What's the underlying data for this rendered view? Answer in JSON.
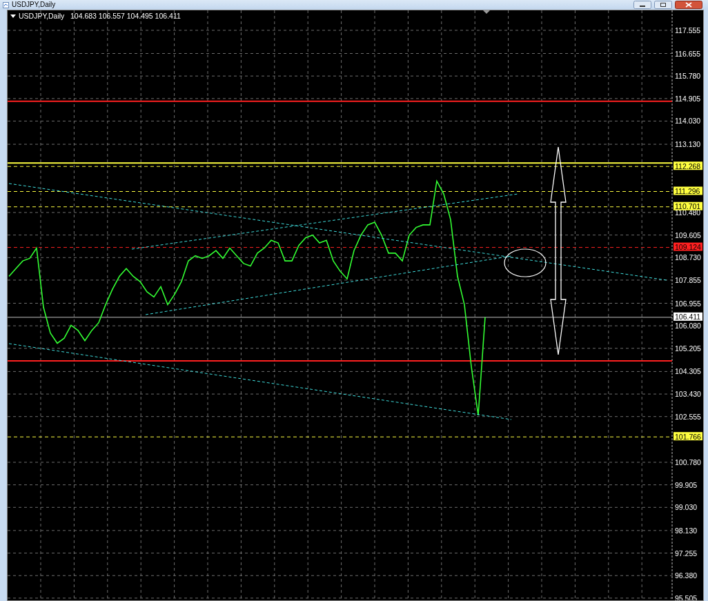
{
  "window": {
    "title": "USDJPY,Daily"
  },
  "chart": {
    "symbol": "USDJPY,Daily",
    "ohlc": [
      "104.683",
      "106.557",
      "104.495",
      "106.411"
    ],
    "chart_data": {
      "type": "line",
      "grid": true,
      "ylim": [
        95.42,
        118.33
      ],
      "yticks": [
        {
          "value": 117.555,
          "label": "117.555"
        },
        {
          "value": 116.655,
          "label": "116.655"
        },
        {
          "value": 115.78,
          "label": "115.780"
        },
        {
          "value": 114.905,
          "label": "114.905"
        },
        {
          "value": 114.03,
          "label": "114.030"
        },
        {
          "value": 113.13,
          "label": "113.130"
        },
        {
          "value": 110.48,
          "label": "110.480"
        },
        {
          "value": 109.605,
          "label": "109.605"
        },
        {
          "value": 108.73,
          "label": "108.730"
        },
        {
          "value": 107.855,
          "label": "107.855"
        },
        {
          "value": 106.955,
          "label": "106.955"
        },
        {
          "value": 106.08,
          "label": "106.080"
        },
        {
          "value": 105.205,
          "label": "105.205"
        },
        {
          "value": 104.305,
          "label": "104.305"
        },
        {
          "value": 103.43,
          "label": "103.430"
        },
        {
          "value": 102.555,
          "label": "102.555"
        },
        {
          "value": 100.78,
          "label": "100.780"
        },
        {
          "value": 99.905,
          "label": "99.905"
        },
        {
          "value": 99.03,
          "label": "99.030"
        },
        {
          "value": 98.13,
          "label": "98.130"
        },
        {
          "value": 97.255,
          "label": "97.255"
        },
        {
          "value": 96.38,
          "label": "96.380"
        },
        {
          "value": 95.505,
          "label": "95.505"
        }
      ],
      "series": [
        {
          "color": "#33ff33",
          "values": [
            108.0,
            108.3,
            108.6,
            108.7,
            109.1,
            106.8,
            105.8,
            105.4,
            105.6,
            106.1,
            105.9,
            105.5,
            105.9,
            106.2,
            106.9,
            107.5,
            108.0,
            108.3,
            108.0,
            107.8,
            107.4,
            107.2,
            107.6,
            106.9,
            107.3,
            107.8,
            108.6,
            108.8,
            108.7,
            108.8,
            109.0,
            108.7,
            109.1,
            108.8,
            108.5,
            108.4,
            108.9,
            109.1,
            109.4,
            109.3,
            108.6,
            108.6,
            109.2,
            109.5,
            109.6,
            109.3,
            109.4,
            108.6,
            108.2,
            107.9,
            109.0,
            109.6,
            110.0,
            110.1,
            109.6,
            108.9,
            108.9,
            108.6,
            109.6,
            109.9,
            110.0,
            110.0,
            111.7,
            111.2,
            110.2,
            108.0,
            106.9,
            104.5,
            102.6,
            106.411
          ]
        }
      ],
      "ref_lines": [
        {
          "axis": "y",
          "value": 114.8,
          "color": "#ff2020"
        },
        {
          "axis": "y",
          "value": 104.72,
          "color": "#ff2020"
        },
        {
          "axis": "y",
          "value": 112.401,
          "color": "#ffff40"
        },
        {
          "axis": "y",
          "value": 112.268,
          "color": "#ffff40",
          "label": "112.268"
        },
        {
          "axis": "y",
          "value": 111.296,
          "color": "#ffff40",
          "label": "111.296"
        },
        {
          "axis": "y",
          "value": 110.701,
          "color": "#ffff40",
          "label": "110.701"
        },
        {
          "axis": "y",
          "value": 109.124,
          "color": "#ff2020",
          "label": "109.124"
        },
        {
          "axis": "y",
          "value": 106.411,
          "color": "#c0c0c0",
          "label": "106.411"
        },
        {
          "axis": "y",
          "value": 101.766,
          "color": "#ffff40",
          "label": "101.766"
        }
      ]
    }
  }
}
